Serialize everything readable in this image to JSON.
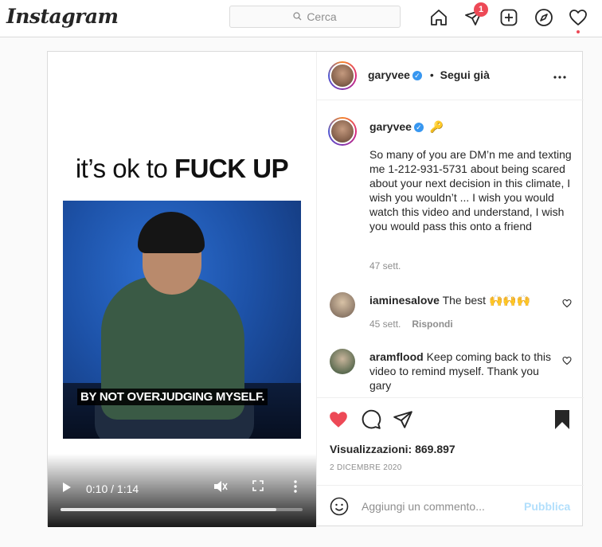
{
  "nav": {
    "logo": "Instagram",
    "search_placeholder": "Cerca",
    "direct_badge": "1"
  },
  "post": {
    "media": {
      "headline_light": "it’s ok to ",
      "headline_bold": "FUCK UP",
      "subtitle": "BY NOT OVERJUDGING MYSELF.",
      "time": "0:10 / 1:14",
      "progress_fraction": 0.89
    },
    "header": {
      "username": "garyvee",
      "separator": "•",
      "follow_status": "Segui già"
    },
    "caption": {
      "username": "garyvee",
      "emoji": "🔑",
      "text": "So many of you are DM’n me and texting me 1-212-931-5731 about being scared about your next decision in this climate, I wish you wouldn’t ... I wish you would watch this video and understand, I wish you would pass this onto a friend",
      "age": "47 sett."
    },
    "comments": [
      {
        "username": "iaminesalove",
        "text": "The best 🙌🙌🙌",
        "age": "45 sett.",
        "reply_label": "Rispondi"
      },
      {
        "username": "aramflood",
        "text": "Keep coming back to this video to remind myself. Thank you gary"
      }
    ],
    "views_label": "Visualizzazioni: 869.897",
    "date": "2 DICEMBRE 2020",
    "add_comment_placeholder": "Aggiungi un commento...",
    "publish_label": "Pubblica"
  },
  "colors": {
    "like_red": "#ed4956",
    "verified_blue": "#3897f0",
    "publish_disabled": "#b2dffc"
  }
}
